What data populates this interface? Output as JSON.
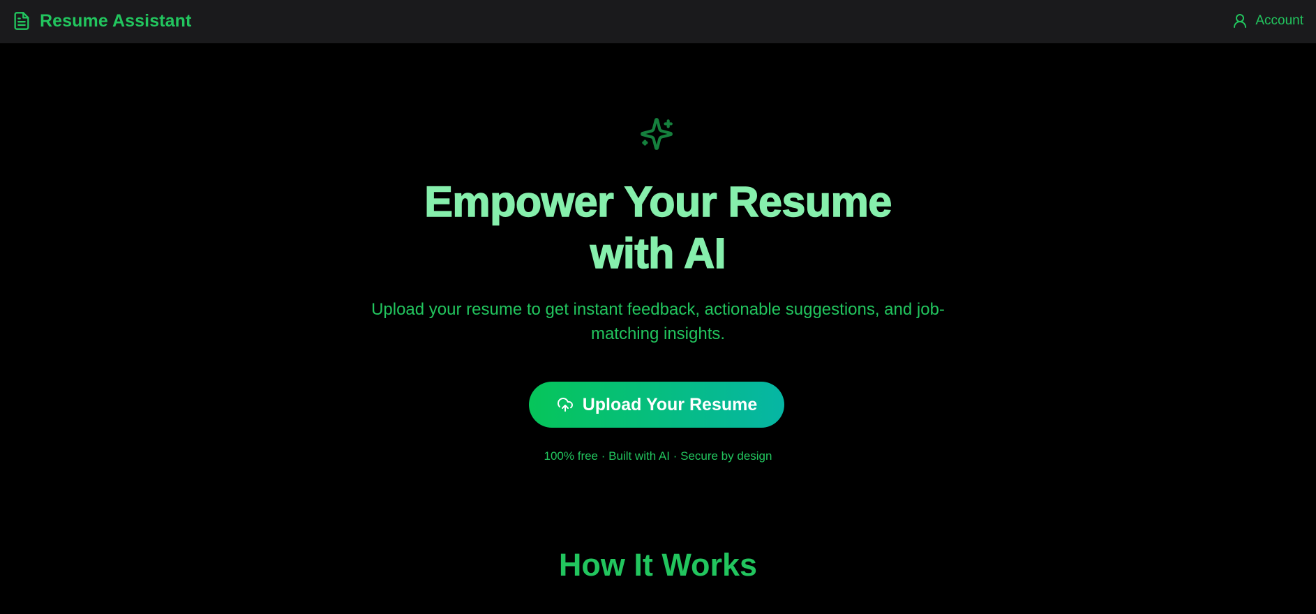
{
  "header": {
    "app_title": "Resume Assistant",
    "logo_icon": "file-text-icon",
    "account_label": "Account",
    "account_icon": "user-icon"
  },
  "hero": {
    "icon": "sparkles-icon",
    "headline_line1": "Empower Your Resume",
    "headline_line2": "with AI",
    "subtitle": "Upload your resume to get instant feedback, actionable suggestions, and job-matching insights.",
    "cta_label": "Upload Your Resume",
    "cta_icon": "cloud-upload-icon",
    "tagline": "100% free · Built with AI · Secure by design"
  },
  "how_it_works": {
    "title": "How It Works"
  },
  "colors": {
    "background": "#000000",
    "header_background": "#1a1a1c",
    "accent": "#22c55e",
    "headline": "#86efac",
    "button_gradient_start": "#06c55a",
    "button_gradient_end": "#06b6a4",
    "button_text": "#ffffff"
  }
}
